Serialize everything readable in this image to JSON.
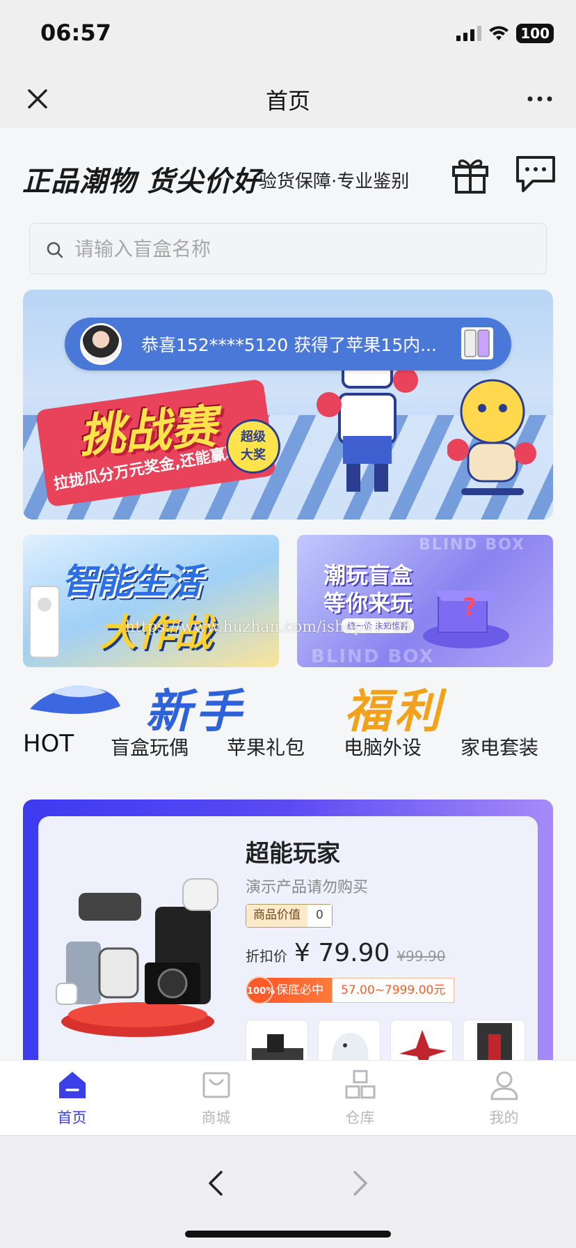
{
  "status_bar": {
    "time": "06:57",
    "battery": "100"
  },
  "nav": {
    "title": "首页"
  },
  "slogan": {
    "main": "正品潮物 货尖价好",
    "sub": "验货保障·专业鉴别"
  },
  "search": {
    "placeholder": "请输入盲盒名称"
  },
  "banner": {
    "notice": "恭喜152****5120 获得了苹果15内...",
    "title": "挑战赛",
    "subtitle": "拉拢瓜分万元奖金,还能赢取",
    "badge_line1": "超级",
    "badge_line2": "大奖"
  },
  "sub_banners": {
    "left_line1": "智能生活",
    "left_line2": "大作战",
    "right_line1": "潮玩盲盒",
    "right_line2": "等你来玩",
    "right_small": "统一价 未知惊喜",
    "blind_box": "BLIND BOX",
    "watermark": "https://www.huzhan.com/ishop51738"
  },
  "newbie": {
    "part1": "新手",
    "part2": "福利"
  },
  "categories": [
    "HOT",
    "盲盒玩偶",
    "苹果礼包",
    "电脑外设",
    "家电套装"
  ],
  "product": {
    "name": "超能玩家",
    "desc": "演示产品请勿购买",
    "value_label": "商品价值",
    "value": "0",
    "price_label": "折扣价",
    "price": "¥ 79.90",
    "original_price": "¥99.90",
    "guarantee_badge": "100%",
    "guarantee_label": "保底必中",
    "guarantee_range": "57.00~7999.00元"
  },
  "tabs": [
    {
      "label": "首页",
      "icon": "home-icon",
      "active": true
    },
    {
      "label": "商城",
      "icon": "shop-bag-icon",
      "active": false
    },
    {
      "label": "仓库",
      "icon": "warehouse-icon",
      "active": false
    },
    {
      "label": "我的",
      "icon": "profile-icon",
      "active": false
    }
  ],
  "colors": {
    "accent": "#3b3fe8",
    "price_orange": "#ff5a2a",
    "tab_inactive": "#b8b8bc"
  }
}
